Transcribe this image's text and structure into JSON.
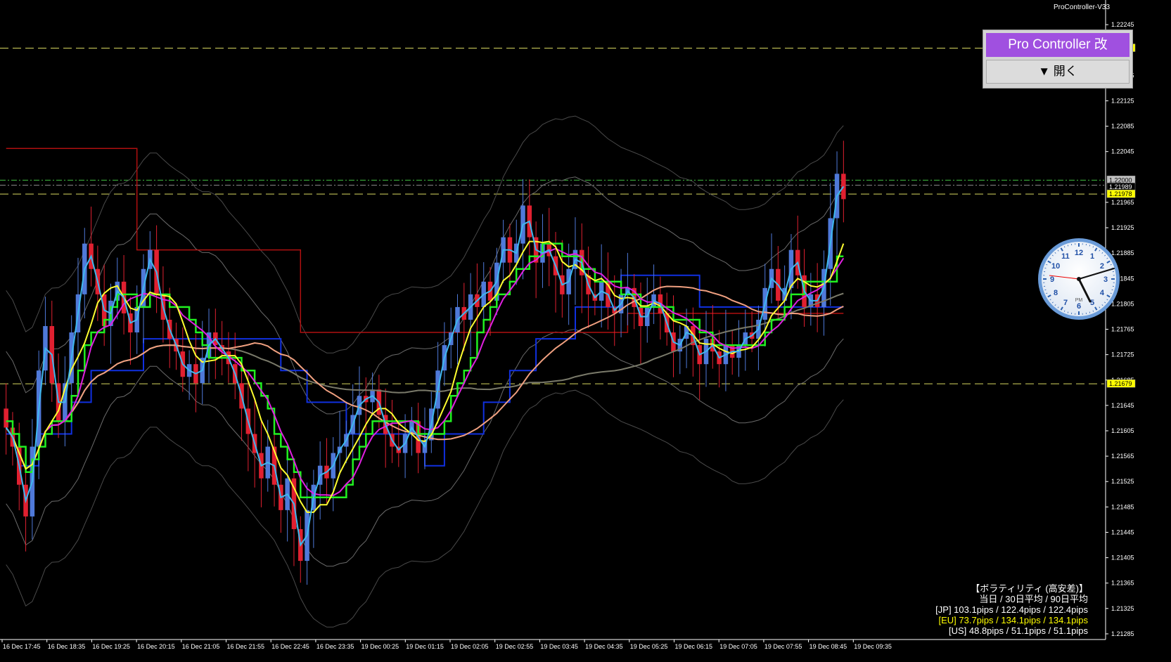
{
  "header": {
    "indicator_name": "ProController-V33"
  },
  "panel": {
    "title": "Pro Controller 改",
    "open_label": "▼ 開く"
  },
  "clock": {
    "numerals": [
      "12",
      "1",
      "2",
      "3",
      "4",
      "5",
      "6",
      "7",
      "8",
      "9",
      "10",
      "11"
    ],
    "period": "PM"
  },
  "volatility": {
    "title": "【ボラティリティ (高安差)】",
    "subtitle": "当日 / 30日平均 / 90日平均",
    "jp": "[JP] 103.1pips / 122.4pips / 122.4pips",
    "eu": "[EU] 73.7pips / 134.1pips / 134.1pips",
    "us": "[US] 48.8pips / 51.1pips / 51.1pips"
  },
  "colors": {
    "bull": "#4f79d9",
    "bear": "#e02030",
    "ma_cyan": "#3fb7ee",
    "ma_yellow": "#ffff30",
    "ma_magenta": "#e020e0",
    "ma_green": "#20f020",
    "ma_salmon": "#f0a080",
    "ma_gray": "#7a7a6a",
    "donchian_blue": "#1030e0",
    "donchian_red": "#b01010",
    "dash_yellow": "#d8d860"
  },
  "chart_data": {
    "type": "candlestick",
    "symbol_pair_axis": "price",
    "ylim": [
      1.21265,
      1.22275
    ],
    "y_ticks": [
      "1.22245",
      "1.22165",
      "1.22125",
      "1.22085",
      "1.22045",
      "1.21965",
      "1.21925",
      "1.21885",
      "1.21845",
      "1.21805",
      "1.21765",
      "1.21725",
      "1.21685",
      "1.21645",
      "1.21605",
      "1.21565",
      "1.21525",
      "1.21485",
      "1.21445",
      "1.21405",
      "1.21365",
      "1.21325",
      "1.21285"
    ],
    "price_labels": [
      {
        "text": "1.22208",
        "value": 1.22208,
        "bg": "#ffff00"
      },
      {
        "text": "1.22000",
        "value": 1.22,
        "bg": "#c0c0c0"
      },
      {
        "text": "1.21989",
        "value": 1.21989,
        "bg": "#000000"
      },
      {
        "text": "1.21978",
        "value": 1.21978,
        "bg": "#ffff00"
      },
      {
        "text": "1.21679",
        "value": 1.21679,
        "bg": "#ffff00"
      }
    ],
    "x_labels": [
      "16 Dec 17:45",
      "16 Dec 18:35",
      "16 Dec 19:25",
      "16 Dec 20:15",
      "16 Dec 21:05",
      "16 Dec 21:55",
      "16 Dec 22:45",
      "16 Dec 23:35",
      "19 Dec 00:25",
      "19 Dec 01:15",
      "19 Dec 02:05",
      "19 Dec 02:55",
      "19 Dec 03:45",
      "19 Dec 04:35",
      "19 Dec 05:25",
      "19 Dec 06:15",
      "19 Dec 07:05",
      "19 Dec 07:55",
      "19 Dec 08:45",
      "19 Dec 09:35"
    ],
    "horizontal_levels": [
      1.22208,
      1.22,
      1.21992,
      1.21978,
      1.21679
    ],
    "close_series": [
      1.2161,
      1.2158,
      1.2152,
      1.2147,
      1.2158,
      1.217,
      1.2177,
      1.2168,
      1.2162,
      1.2168,
      1.2176,
      1.2182,
      1.219,
      1.2186,
      1.2182,
      1.2177,
      1.2181,
      1.2184,
      1.2179,
      1.2176,
      1.218,
      1.2186,
      1.2189,
      1.2182,
      1.2178,
      1.2175,
      1.2173,
      1.2169,
      1.2171,
      1.2168,
      1.2172,
      1.2176,
      1.2174,
      1.2173,
      1.2171,
      1.2168,
      1.2164,
      1.216,
      1.2157,
      1.2153,
      1.2158,
      1.2152,
      1.2148,
      1.2153,
      1.2145,
      1.214,
      1.2148,
      1.2152,
      1.2155,
      1.2153,
      1.2157,
      1.2158,
      1.216,
      1.2163,
      1.2166,
      1.2165,
      1.2167,
      1.2163,
      1.216,
      1.2158,
      1.2157,
      1.216,
      1.2162,
      1.2157,
      1.2159,
      1.2164,
      1.217,
      1.2174,
      1.2176,
      1.218,
      1.2178,
      1.2182,
      1.218,
      1.2184,
      1.2181,
      1.2187,
      1.2191,
      1.2187,
      1.219,
      1.2196,
      1.2191,
      1.2187,
      1.219,
      1.2188,
      1.2185,
      1.2182,
      1.2186,
      1.2189,
      1.2185,
      1.2182,
      1.2181,
      1.2184,
      1.218,
      1.2179,
      1.2182,
      1.2183,
      1.218,
      1.2177,
      1.218,
      1.2182,
      1.2179,
      1.2176,
      1.2173,
      1.2175,
      1.2177,
      1.2174,
      1.2171,
      1.2175,
      1.2173,
      1.2171,
      1.2174,
      1.2172,
      1.2174,
      1.2176,
      1.2175,
      1.2178,
      1.2183,
      1.2186,
      1.2181,
      1.2183,
      1.2189,
      1.2185,
      1.218,
      1.2182,
      1.218,
      1.2186,
      1.2194,
      1.2201,
      1.2197
    ]
  }
}
